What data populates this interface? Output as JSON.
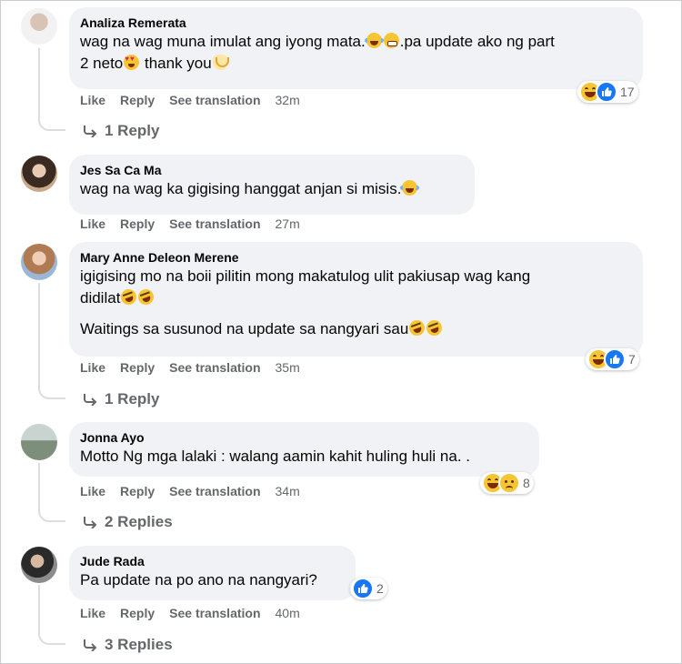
{
  "actions": {
    "like": "Like",
    "reply": "Reply",
    "translate": "See translation"
  },
  "comments": [
    {
      "author": "Analiza Remerata",
      "text_line1_a": "wag na wag muna imulat ang iyong mata.",
      "text_line1_b": ".pa update ako ng part",
      "text_line2_a": "2 neto",
      "text_line2_b": " thank you",
      "time": "32m",
      "reaction_count": "17",
      "replies": "1 Reply"
    },
    {
      "author": "Jes Sa Ca Ma",
      "text": "wag na wag ka gigising hanggat anjan si misis.",
      "time": "27m"
    },
    {
      "author": "Mary Anne Deleon Merene",
      "text_line1": "igigising mo na boii pilitin mong makatulog ulit pakiusap wag kang",
      "text_line2": "didilat",
      "text_line3": "Waitings sa susunod na update sa nangyari sau",
      "time": "35m",
      "reaction_count": "7",
      "replies": "1 Reply"
    },
    {
      "author": "Jonna Ayo",
      "text": "Motto Ng mga lalaki : walang aamin kahit huling huli na. .",
      "time": "34m",
      "reaction_count": "8",
      "replies": "2 Replies"
    },
    {
      "author": "Jude Rada",
      "text": "Pa update na po ano na nangyari?",
      "time": "40m",
      "reaction_count": "2",
      "replies": "3 Replies"
    }
  ],
  "colors": {
    "bubble": "#f0f2f5",
    "secondary_text": "#65676b",
    "like_blue": "#1877f2",
    "haha_yellow": "#f7c533"
  },
  "icons": [
    "reply-arrow-icon",
    "haha-reaction-icon",
    "like-reaction-icon",
    "sad-reaction-icon",
    "emoji-icon"
  ]
}
